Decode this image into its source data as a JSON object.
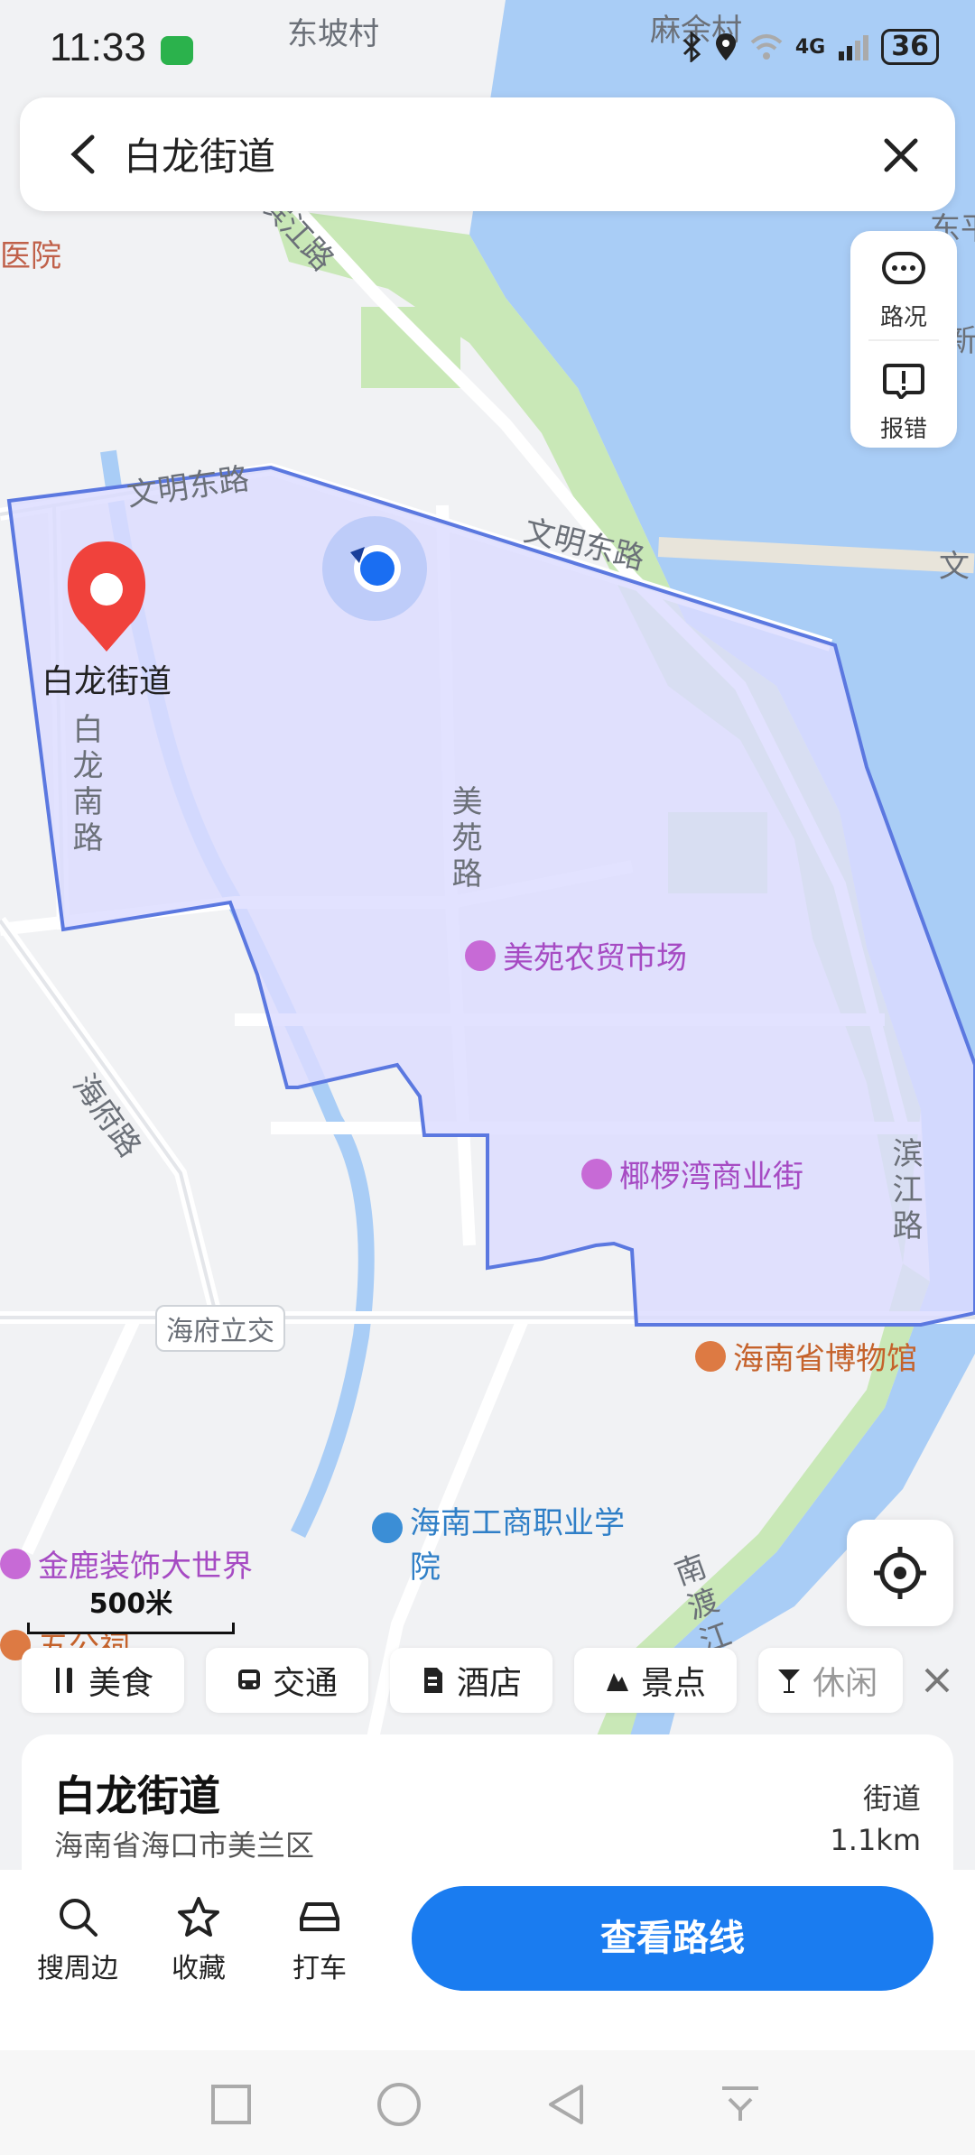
{
  "status": {
    "time": "11:33",
    "network": "4G",
    "battery": "36"
  },
  "search": {
    "title": "白龙街道"
  },
  "side_panel": {
    "traffic": "路况",
    "report": "报错"
  },
  "map": {
    "place_labels": [
      "东坡村",
      "麻余村",
      "医院",
      "东平",
      "新",
      "文"
    ],
    "roads": [
      "滨江路",
      "文明东路",
      "文明东路",
      "白龙南路",
      "美苑路",
      "海府路",
      "滨江路",
      "南渡江"
    ],
    "interchange": "海府立交",
    "marker_label": "白龙街道",
    "pois": [
      {
        "name": "美苑农贸市场",
        "kind": "shop"
      },
      {
        "name": "椰椤湾商业街",
        "kind": "shop"
      },
      {
        "name": "海南省博物馆",
        "kind": "museum"
      },
      {
        "name": "海南工商职业学院",
        "kind": "school"
      },
      {
        "name": "金鹿装饰大世界",
        "kind": "shop"
      },
      {
        "name": "五公祠",
        "kind": "scenic"
      }
    ],
    "scale": "500米"
  },
  "categories": [
    "美食",
    "交通",
    "酒店",
    "景点",
    "休闲"
  ],
  "place_card": {
    "name": "白龙街道",
    "address": "海南省海口市美兰区",
    "type": "街道",
    "distance": "1.1km"
  },
  "actions": {
    "nearby": "搜周边",
    "favorite": "收藏",
    "taxi": "打车",
    "route": "查看路线"
  },
  "colors": {
    "accent": "#1a7cf0",
    "area_fill": "#dcdcff",
    "area_stroke": "#5b78e0",
    "water": "#a9cdf6",
    "green": "#c9e8b7"
  }
}
